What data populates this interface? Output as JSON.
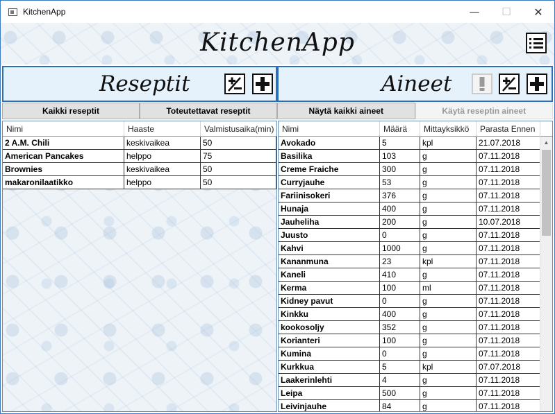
{
  "window": {
    "title": "KitchenApp"
  },
  "header": {
    "app_title": "KitchenApp"
  },
  "recipes": {
    "title": "Reseptit",
    "tabs": [
      "Kaikki reseptit",
      "Toteutettavat reseptit"
    ],
    "columns": [
      "Nimi",
      "Haaste",
      "Valmistusaika(min)"
    ],
    "rows": [
      [
        "2 A.M. Chili",
        "keskivaikea",
        "50"
      ],
      [
        "American Pancakes",
        "helppo",
        "75"
      ],
      [
        "Brownies",
        "keskivaikea",
        "50"
      ],
      [
        "makaronilaatikko",
        "helppo",
        "50"
      ]
    ]
  },
  "ingredients": {
    "title": "Aineet",
    "tabs": [
      "Näytä kaikki aineet",
      "Käytä reseptin aineet"
    ],
    "columns": [
      "Nimi",
      "Määrä",
      "Mittayksikkö",
      "Parasta Ennen"
    ],
    "rows": [
      [
        "Avokado",
        "5",
        "kpl",
        "21.07.2018"
      ],
      [
        "Basilika",
        "103",
        "g",
        "07.11.2018"
      ],
      [
        "Creme Fraiche",
        "300",
        "g",
        "07.11.2018"
      ],
      [
        "Curryjauhe",
        "53",
        "g",
        "07.11.2018"
      ],
      [
        "Fariinisokeri",
        "376",
        "g",
        "07.11.2018"
      ],
      [
        "Hunaja",
        "400",
        "g",
        "07.11.2018"
      ],
      [
        "Jauheliha",
        "200",
        "g",
        "10.07.2018"
      ],
      [
        "Juusto",
        "0",
        "g",
        "07.11.2018"
      ],
      [
        "Kahvi",
        "1000",
        "g",
        "07.11.2018"
      ],
      [
        "Kananmuna",
        "23",
        "kpl",
        "07.11.2018"
      ],
      [
        "Kaneli",
        "410",
        "g",
        "07.11.2018"
      ],
      [
        "Kerma",
        "100",
        "ml",
        "07.11.2018"
      ],
      [
        "Kidney pavut",
        "0",
        "g",
        "07.11.2018"
      ],
      [
        "Kinkku",
        "400",
        "g",
        "07.11.2018"
      ],
      [
        "kookosoljy",
        "352",
        "g",
        "07.11.2018"
      ],
      [
        "Korianteri",
        "100",
        "g",
        "07.11.2018"
      ],
      [
        "Kumina",
        "0",
        "g",
        "07.11.2018"
      ],
      [
        "Kurkkua",
        "5",
        "kpl",
        "07.07.2018"
      ],
      [
        "Laakerinlehti",
        "4",
        "g",
        "07.11.2018"
      ],
      [
        "Leipa",
        "500",
        "g",
        "07.11.2018"
      ],
      [
        "Leivinjauhe",
        "84",
        "g",
        "07.11.2018"
      ]
    ]
  }
}
